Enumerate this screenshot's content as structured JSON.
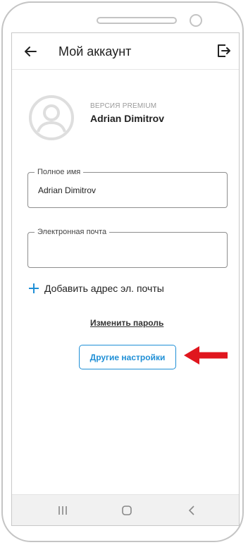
{
  "header": {
    "title": "Мой аккаунт",
    "back_icon": "arrow-left-icon",
    "logout_icon": "logout-icon"
  },
  "profile": {
    "account_type": "ВЕРСИЯ PREMIUM",
    "name": "Adrian Dimitrov",
    "avatar_icon": "person-avatar-icon"
  },
  "form": {
    "full_name": {
      "label": "Полное имя",
      "value": "Adrian Dimitrov"
    },
    "email": {
      "label": "Электронная почта",
      "value": ""
    }
  },
  "actions": {
    "add_email": "Добавить адрес эл. почты",
    "change_password": "Изменить пароль",
    "other_settings": "Другие настройки"
  },
  "colors": {
    "accent": "#1f8fd6",
    "annotation_arrow": "#e0161e"
  },
  "nav": {
    "recent_icon": "recent-apps-icon",
    "home_icon": "home-icon",
    "back_icon": "back-chevron-icon"
  }
}
